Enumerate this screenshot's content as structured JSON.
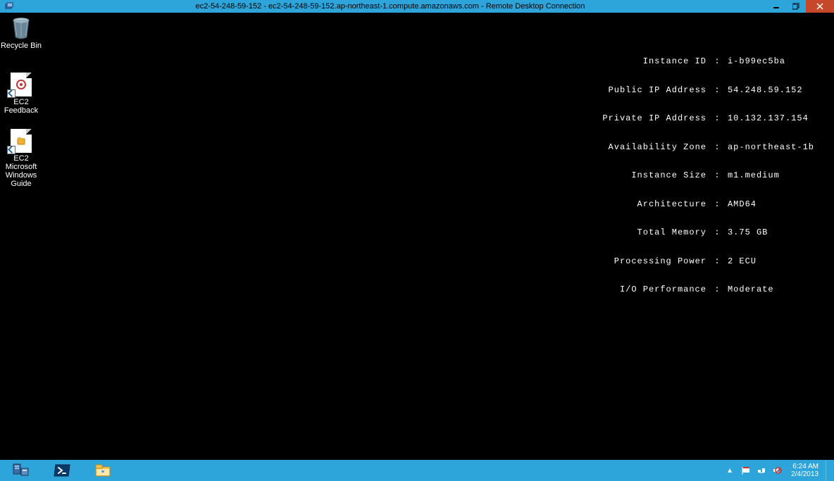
{
  "titlebar": {
    "text": "ec2-54-248-59-152 - ec2-54-248-59-152.ap-northeast-1.compute.amazonaws.com - Remote Desktop Connection"
  },
  "desktop_icons": {
    "recycle_bin": "Recycle Bin",
    "ec2_feedback": "EC2\nFeedback",
    "ec2_guide": "EC2\nMicrosoft\nWindows\nGuide"
  },
  "instance_info": [
    {
      "key": "Instance ID",
      "val": "i-b99ec5ba"
    },
    {
      "key": "Public IP Address",
      "val": "54.248.59.152"
    },
    {
      "key": "Private IP Address",
      "val": "10.132.137.154"
    },
    {
      "key": "Availability Zone",
      "val": "ap-northeast-1b"
    },
    {
      "key": "Instance Size",
      "val": "m1.medium"
    },
    {
      "key": "Architecture",
      "val": "AMD64"
    },
    {
      "key": "Total Memory",
      "val": "3.75 GB"
    },
    {
      "key": "Processing Power",
      "val": "2 ECU"
    },
    {
      "key": "I/O Performance",
      "val": "Moderate"
    }
  ],
  "clock": {
    "time": "6:24 AM",
    "date": "2/4/2013"
  }
}
